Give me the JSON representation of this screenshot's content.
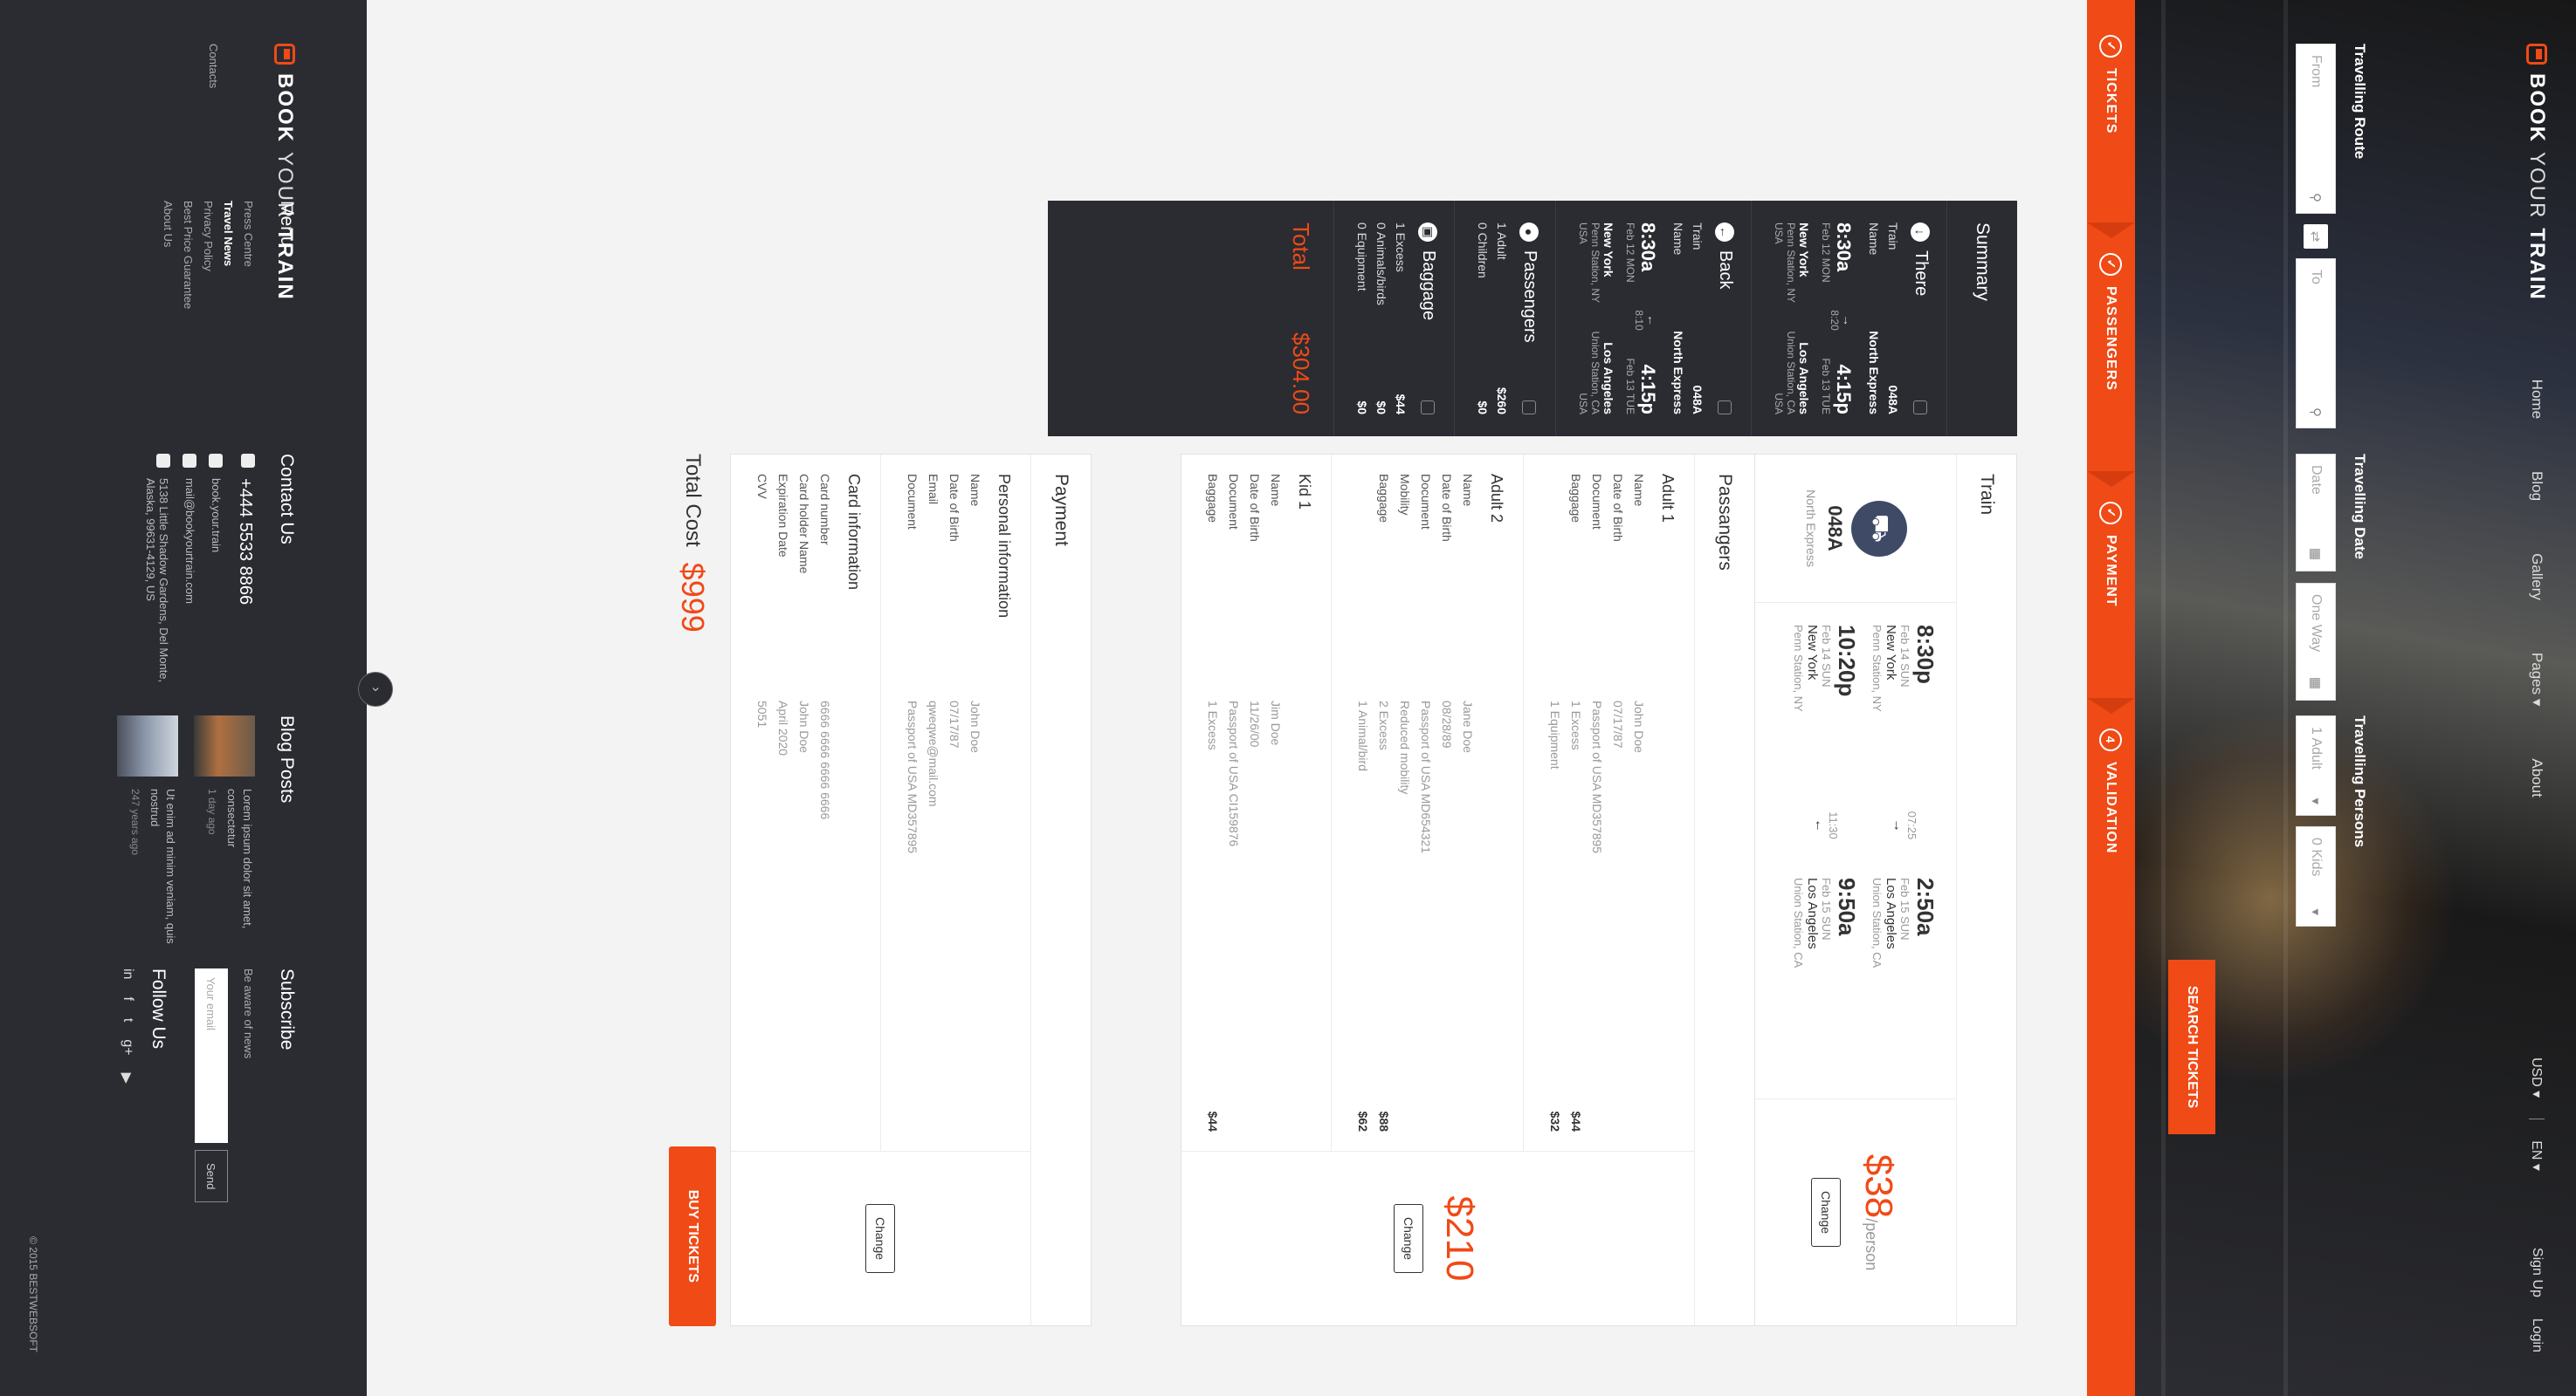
{
  "brand": {
    "bold": "BOOK",
    "light": "YOUR",
    "tail": "TRAIN"
  },
  "nav": {
    "items": [
      "Home",
      "Blog",
      "Gallery",
      "Pages ▾",
      "About"
    ],
    "sign_up": "Sign Up",
    "login": "Login",
    "currency": "USD ▾",
    "lang": "EN ▾"
  },
  "search": {
    "route_label": "Travelling Route",
    "from_placeholder": "From",
    "to_placeholder": "To",
    "date_label": "Travelling Date",
    "date_placeholder": "Date",
    "trip_type": "One Way",
    "persons_label": "Travelling Persons",
    "adults": "1 Adult",
    "kids": "0 Kids",
    "button": "SEARCH TICKETS"
  },
  "steps": [
    {
      "icon": "✓",
      "label": "TICKETS"
    },
    {
      "icon": "✓",
      "label": "PASSENGERS"
    },
    {
      "icon": "✓",
      "label": "PAYMENT"
    },
    {
      "icon": "4",
      "label": "VALIDATION"
    }
  ],
  "summary": {
    "title": "Summary",
    "there": {
      "title": "There",
      "train_label": "Train",
      "train": "048A",
      "name_label": "Name",
      "name": "North Express",
      "from_city": "New York",
      "from_station": "Penn Station, NY USA",
      "from_time": "8:30a",
      "from_date": "Feb 12 MON",
      "dur": "8:20",
      "to_city": "Los Angeles",
      "to_station": "Union Station, CA USA",
      "to_time": "4:15p",
      "to_date": "Feb 13 TUE"
    },
    "back": {
      "title": "Back",
      "train_label": "Train",
      "train": "048A",
      "name_label": "Name",
      "name": "North Express",
      "from_city": "New York",
      "from_station": "Penn Station, NY USA",
      "from_time": "8:30a",
      "from_date": "Feb 12 MON",
      "dur": "8:10",
      "to_city": "Los Angeles",
      "to_station": "Union Station, CA USA",
      "to_time": "4:15p",
      "to_date": "Feb 13 TUE"
    },
    "passengers": {
      "title": "Passengers",
      "r1": "1 Adult",
      "p1": "$260",
      "r2": "0 Children",
      "p2": "$0"
    },
    "baggage": {
      "title": "Baggage",
      "r1": "1 Excess",
      "p1": "$44",
      "r2": "0 Animals/birds",
      "p2": "$0",
      "r3": "0 Equipment",
      "p3": "$0"
    },
    "total_label": "Total",
    "total": "$304.00"
  },
  "train": {
    "title": "Train",
    "code": "048A",
    "name": "North Express",
    "out_dep_time": "8:30p",
    "out_dep_date": "Feb 14 SUN",
    "out_dep_city": "New York",
    "out_dep_station": "Penn Station, NY",
    "out_dur": "07:25",
    "out_arr_time": "2:50a",
    "out_arr_date": "Feb 15 SUN",
    "out_arr_city": "Los Angeles",
    "out_arr_station": "Union Station, CA",
    "ret_dep_time": "10:20p",
    "ret_dep_date": "Feb 14 SUN",
    "ret_dep_city": "New York",
    "ret_dep_station": "Penn Station, NY",
    "ret_dur": "11:30",
    "ret_arr_time": "9:50a",
    "ret_arr_date": "Feb 15 SUN",
    "ret_arr_city": "Los Angeles",
    "ret_arr_station": "Union Station, CA",
    "price": "$38",
    "per": "/person",
    "change": "Change"
  },
  "passengers": {
    "title": "Passangers",
    "price": "$210",
    "change": "Change",
    "adult1": {
      "title": "Adult 1",
      "name_k": "Name",
      "name": "John Doe",
      "dob_k": "Date of Birth",
      "dob": "07/17/87",
      "doc_k": "Document",
      "doc": "Passport of USA MD357895",
      "bag_k": "Baggage",
      "bag1": "1 Excess",
      "bag1_p": "$44",
      "bag2": "1 Equipment",
      "bag2_p": "$32"
    },
    "adult2": {
      "title": "Adult 2",
      "name_k": "Name",
      "name": "Jane Doe",
      "dob_k": "Date of Birth",
      "dob": "08/28/89",
      "doc_k": "Document",
      "doc": "Passport of USA MD654321",
      "mob_k": "Mobility",
      "mob": "Reduced mobility",
      "bag_k": "Baggage",
      "bag1": "2 Excess",
      "bag1_p": "$88",
      "bag2": "1 Animal/bird",
      "bag2_p": "$62"
    },
    "kid1": {
      "title": "Kid 1",
      "name_k": "Name",
      "name": "Jim Doe",
      "dob_k": "Date of Birth",
      "dob": "11/26/00",
      "doc_k": "Document",
      "doc": "Passport of USA CI159876",
      "bag_k": "Baggage",
      "bag1": "1 Excess",
      "bag1_p": "$44"
    }
  },
  "payment": {
    "title": "Payment",
    "change": "Change",
    "personal_title": "Personal information",
    "name_k": "Name",
    "name": "John Doe",
    "dob_k": "Date of Birth",
    "dob": "07/17/87",
    "email_k": "Email",
    "email": "qweqwe@mail.com",
    "doc_k": "Document",
    "doc": "Passport of USA MD357895",
    "card_title": "Card information",
    "num_k": "Card number",
    "num": "6666 6666 6666 6666",
    "holder_k": "Card holder Name",
    "holder": "John Doe",
    "exp_k": "Expiration Date",
    "exp": "April 2020",
    "cvv_k": "CVV",
    "cvv": "5051"
  },
  "total": {
    "label": "Total Cost",
    "amount": "$999",
    "buy": "BUY TICKETS"
  },
  "footer": {
    "menu_title": "Menu",
    "menu": [
      "Press Centre",
      "Travel News",
      "Privacy Policy",
      "Best Price Guarantee",
      "About Us",
      "Contacts"
    ],
    "contact_title": "Contact Us",
    "phone": "+444 5533 8866",
    "skype": "book.your.train",
    "mail": "mail@bookyourtrain.com",
    "address": "5138 Little Shadow Gardens, Del Monte, Alaska, 99631-4129, US",
    "blog_title": "Blog Posts",
    "post1": "Lorem ipsum dolor sit amet, consectetur",
    "post1_ago": "1 day ago",
    "post2": "Ut enim ad minim veniam, quis nostrud",
    "post2_ago": "247 years ago",
    "subscribe_title": "Subscribe",
    "subscribe_text": "Be aware of news",
    "email_placeholder": "Your email",
    "send": "Send",
    "follow_title": "Follow Us",
    "copyright": "© 2015 BESTWEBSOFT"
  }
}
